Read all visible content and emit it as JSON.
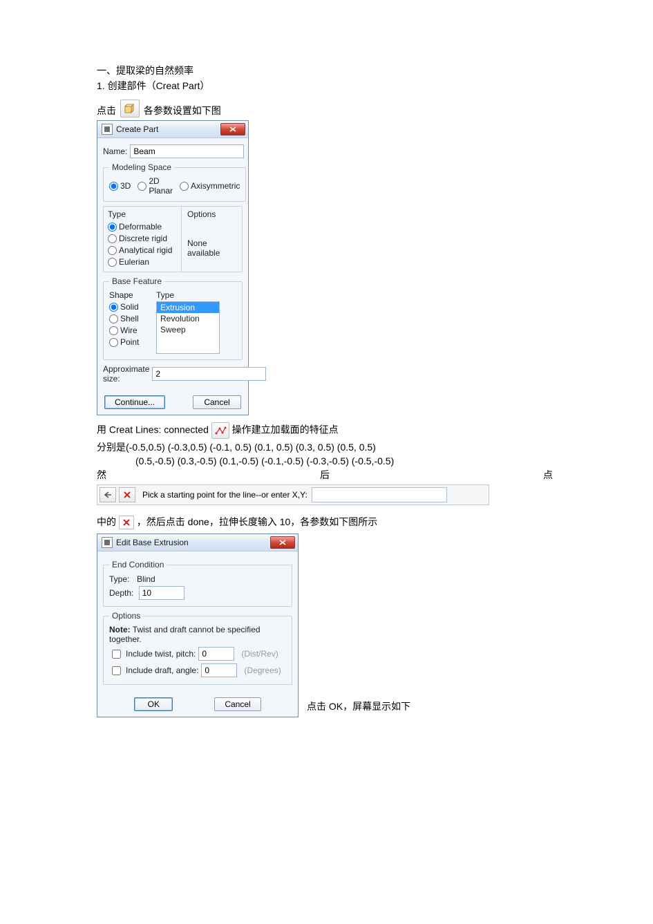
{
  "doc": {
    "h1": "一、提取梁的自然频率",
    "step1": "1.  创建部件（Creat Part）",
    "click_pre": "点击",
    "click_post": "各参数设置如下图",
    "lines_pre": "用 Creat Lines: connected",
    "lines_post": "操作建立加载面的特征点",
    "coords1": "分别是(-0.5,0.5)  (-0.3,0.5)  (-0.1, 0.5)  (0.1, 0.5)  (0.3, 0.5)  (0.5, 0.5)",
    "coords2": "(0.5,-0.5) (0.3,-0.5)  (0.1,-0.5) (-0.1,-0.5) (-0.3,-0.5)  (-0.5,-0.5)",
    "then_l": "然",
    "then_m": "后",
    "then_r": "点",
    "mid_pre": "中的",
    "mid_post": "，然后点击 done，拉伸长度输入 10，各参数如下图所示",
    "ok_note": "点击 OK，屏幕显示如下"
  },
  "create_part": {
    "title": "Create Part",
    "name_label": "Name:",
    "name_value": "Beam",
    "modeling_space": "Modeling Space",
    "ms_3d": "3D",
    "ms_2d": "2D Planar",
    "ms_axi": "Axisymmetric",
    "type_h": "Type",
    "options_h": "Options",
    "t_def": "Deformable",
    "t_dr": "Discrete rigid",
    "t_ar": "Analytical rigid",
    "t_eu": "Eulerian",
    "opt_none": "None available",
    "base_feature": "Base Feature",
    "shape_h": "Shape",
    "shape_solid": "Solid",
    "shape_shell": "Shell",
    "shape_wire": "Wire",
    "shape_point": "Point",
    "bf_type_h": "Type",
    "li_ext": "Extrusion",
    "li_rev": "Revolution",
    "li_swp": "Sweep",
    "approx_label": "Approximate size:",
    "approx_value": "2",
    "continue": "Continue...",
    "cancel": "Cancel"
  },
  "prompt_bar": {
    "text": "Pick a starting point for the line--or enter X,Y:"
  },
  "extrusion": {
    "title": "Edit Base Extrusion",
    "end_cond": "End Condition",
    "type_label": "Type:",
    "type_value": "Blind",
    "depth_label": "Depth:",
    "depth_value": "10",
    "options": "Options",
    "note_b": "Note:",
    "note_t": "Twist and draft cannot be specified together.",
    "twist_label": "Include twist, pitch:",
    "twist_val": "0",
    "twist_unit": "(Dist/Rev)",
    "draft_label": "Include draft, angle:",
    "draft_val": "0",
    "draft_unit": "(Degrees)",
    "ok": "OK",
    "cancel": "Cancel"
  }
}
